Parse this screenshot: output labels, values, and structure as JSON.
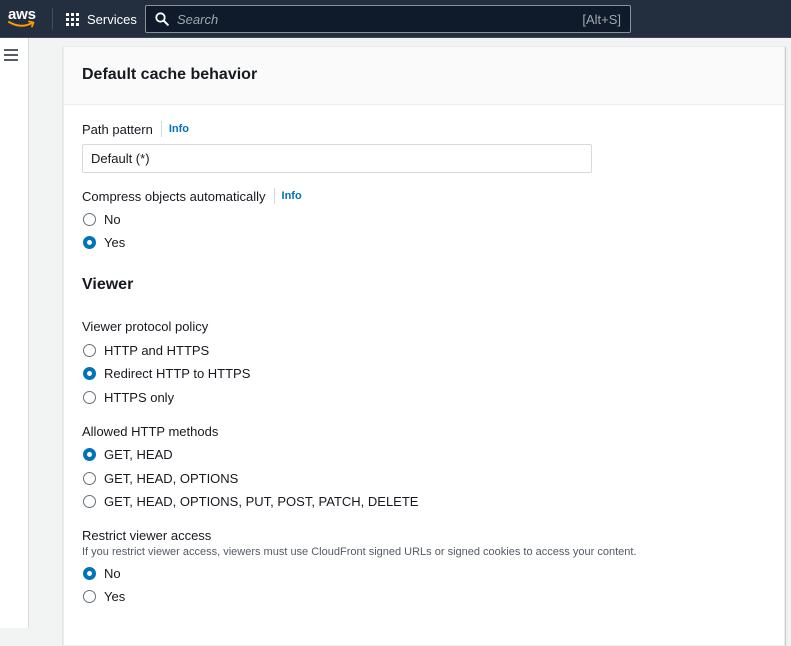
{
  "topbar": {
    "logo_text": "aws",
    "services_label": "Services",
    "search_placeholder": "Search",
    "search_shortcut": "[Alt+S]"
  },
  "panel": {
    "title": "Default cache behavior",
    "path_pattern": {
      "label": "Path pattern",
      "info": "Info",
      "value": "Default (*)"
    },
    "compress": {
      "label": "Compress objects automatically",
      "info": "Info",
      "options": [
        "No",
        "Yes"
      ],
      "selected": "Yes"
    },
    "viewer_title": "Viewer",
    "viewer_protocol": {
      "label": "Viewer protocol policy",
      "options": [
        "HTTP and HTTPS",
        "Redirect HTTP to HTTPS",
        "HTTPS only"
      ],
      "selected": "Redirect HTTP to HTTPS"
    },
    "allowed_methods": {
      "label": "Allowed HTTP methods",
      "options": [
        "GET, HEAD",
        "GET, HEAD, OPTIONS",
        "GET, HEAD, OPTIONS, PUT, POST, PATCH, DELETE"
      ],
      "selected": "GET, HEAD"
    },
    "restrict_access": {
      "label": "Restrict viewer access",
      "description": "If you restrict viewer access, viewers must use CloudFront signed URLs or signed cookies to access your content.",
      "options": [
        "No",
        "Yes"
      ],
      "selected": "No"
    }
  },
  "colors": {
    "topbar_bg": "#232f3e",
    "accent": "#0073bb",
    "aws_orange": "#ff9900"
  }
}
